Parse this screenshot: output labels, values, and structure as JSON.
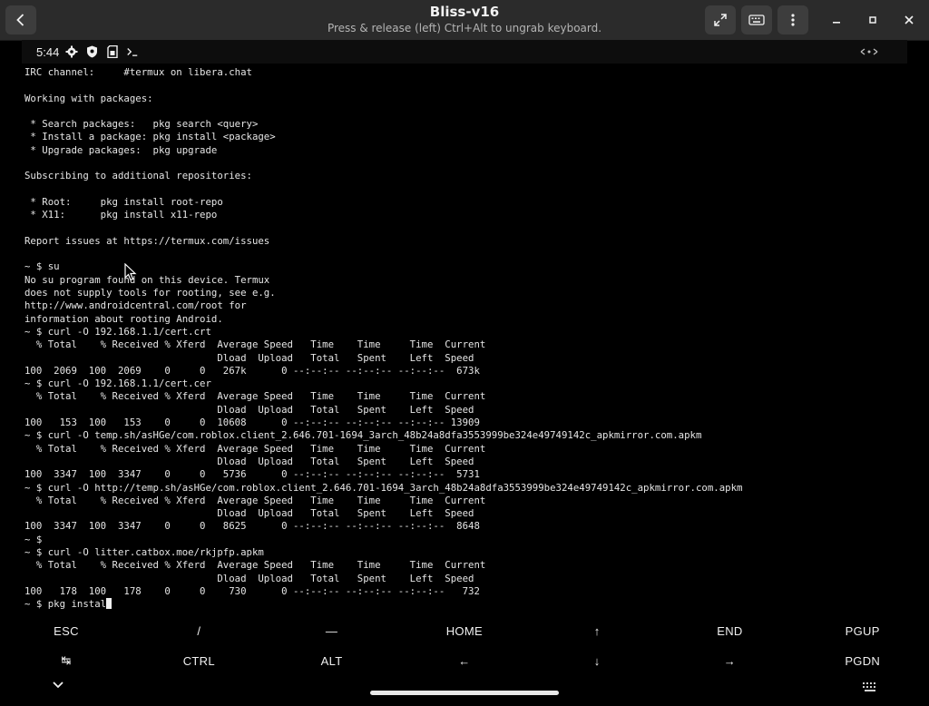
{
  "window": {
    "title": "Bliss-v16",
    "subtitle": "Press & release (left) Ctrl+Alt to ungrab keyboard."
  },
  "status_bar": {
    "time": "5:44"
  },
  "terminal": {
    "lines": [
      "IRC channel:     #termux on libera.chat",
      "",
      "Working with packages:",
      "",
      " * Search packages:   pkg search <query>",
      " * Install a package: pkg install <package>",
      " * Upgrade packages:  pkg upgrade",
      "",
      "Subscribing to additional repositories:",
      "",
      " * Root:     pkg install root-repo",
      " * X11:      pkg install x11-repo",
      "",
      "Report issues at https://termux.com/issues",
      "",
      "~ $ su",
      "No su program found on this device. Termux",
      "does not supply tools for rooting, see e.g.",
      "http://www.androidcentral.com/root for",
      "information about rooting Android.",
      "~ $ curl -O 192.168.1.1/cert.crt",
      "  % Total    % Received % Xferd  Average Speed   Time    Time     Time  Current",
      "                                 Dload  Upload   Total   Spent    Left  Speed",
      "100  2069  100  2069    0     0   267k      0 --:--:-- --:--:-- --:--:--  673k",
      "~ $ curl -O 192.168.1.1/cert.cer",
      "  % Total    % Received % Xferd  Average Speed   Time    Time     Time  Current",
      "                                 Dload  Upload   Total   Spent    Left  Speed",
      "100   153  100   153    0     0  10608      0 --:--:-- --:--:-- --:--:-- 13909",
      "~ $ curl -O temp.sh/asHGe/com.roblox.client_2.646.701-1694_3arch_48b24a8dfa3553999be324e49749142c_apkmirror.com.apkm",
      "  % Total    % Received % Xferd  Average Speed   Time    Time     Time  Current",
      "                                 Dload  Upload   Total   Spent    Left  Speed",
      "100  3347  100  3347    0     0   5736      0 --:--:-- --:--:-- --:--:--  5731",
      "~ $ curl -O http://temp.sh/asHGe/com.roblox.client_2.646.701-1694_3arch_48b24a8dfa3553999be324e49749142c_apkmirror.com.apkm",
      "  % Total    % Received % Xferd  Average Speed   Time    Time     Time  Current",
      "                                 Dload  Upload   Total   Spent    Left  Speed",
      "100  3347  100  3347    0     0   8625      0 --:--:-- --:--:-- --:--:--  8648",
      "~ $",
      "~ $ curl -O litter.catbox.moe/rkjpfp.apkm",
      "  % Total    % Received % Xferd  Average Speed   Time    Time     Time  Current",
      "                                 Dload  Upload   Total   Spent    Left  Speed",
      "100   178  100   178    0     0    730      0 --:--:-- --:--:-- --:--:--   732"
    ],
    "input_line": "~ $ pkg instal"
  },
  "extra_keys": {
    "row1": [
      "ESC",
      "/",
      "—",
      "HOME",
      "↑",
      "END",
      "PGUP"
    ],
    "row2": [
      "↹",
      "CTRL",
      "ALT",
      "←",
      "↓",
      "→",
      "PGDN"
    ]
  },
  "icons": {
    "back": "chevron-left-icon",
    "fullscreen": "expand-icon",
    "keyboard": "keyboard-icon",
    "menu": "kebab-menu-icon",
    "minimize": "minimize-icon",
    "maximize": "maximize-icon",
    "close": "close-icon"
  }
}
